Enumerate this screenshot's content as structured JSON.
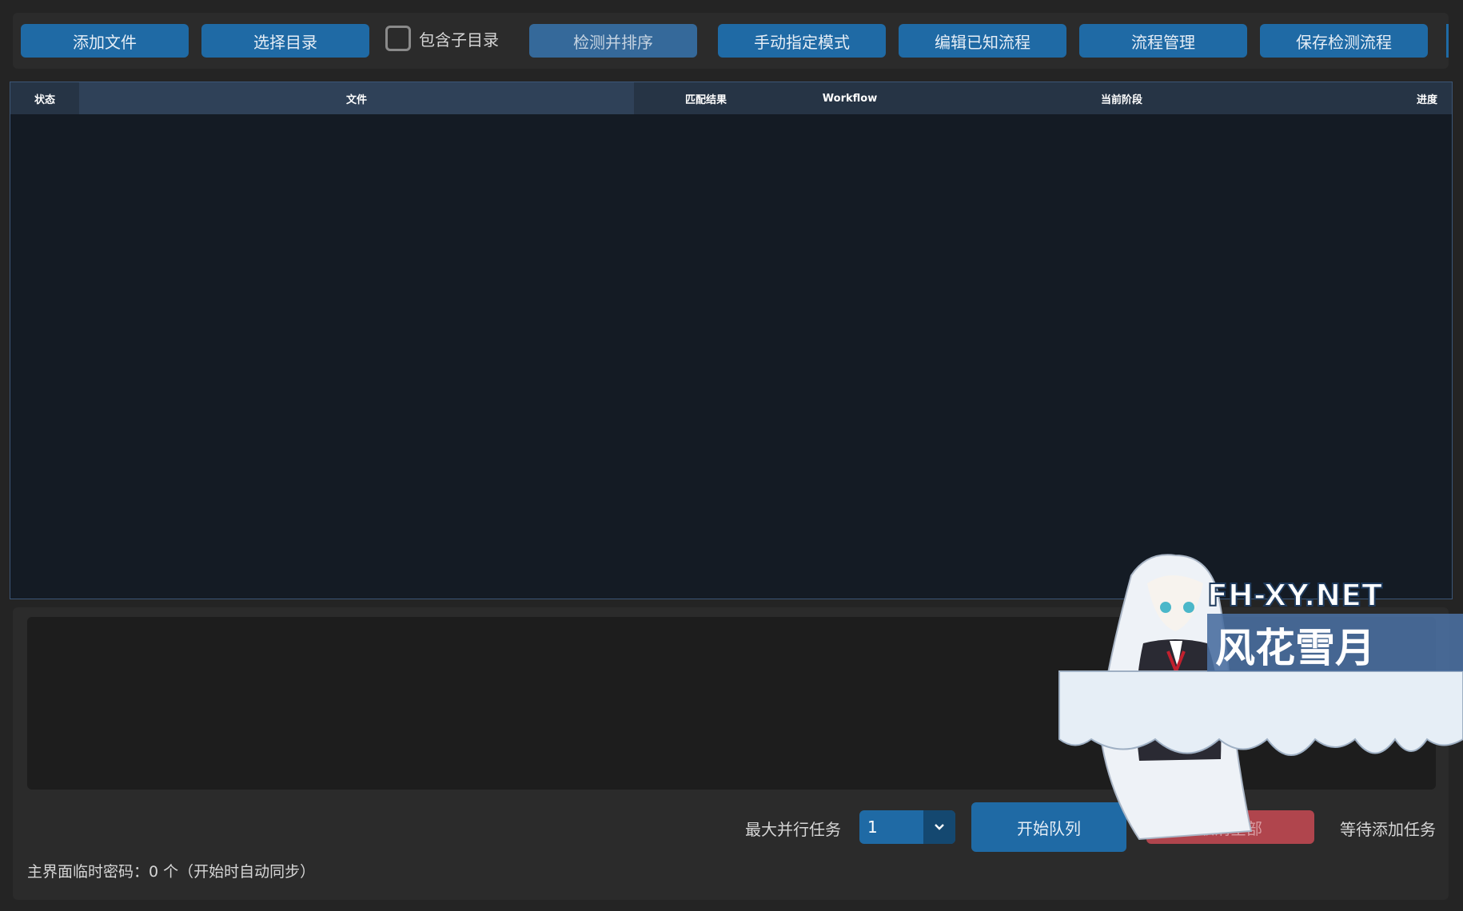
{
  "toolbar": {
    "add_file": "添加文件",
    "select_dir": "选择目录",
    "include_subdirs": "包含子目录",
    "detect_sort": "检测并排序",
    "manual_mode": "手动指定模式",
    "edit_known": "编辑已知流程",
    "manage_flow": "流程管理",
    "save_flow": "保存检测流程"
  },
  "table": {
    "columns": [
      "状态",
      "文件",
      "匹配结果",
      "Workflow",
      "当前阶段",
      "进度"
    ]
  },
  "controls": {
    "max_parallel_label": "最大并行任务",
    "max_parallel_value": "1",
    "start_queue": "开始队列",
    "cancel_all": "取消全部",
    "status": "等待添加任务"
  },
  "footer": {
    "temp_password": "主界面临时密码：0 个（开始时自动同步）"
  },
  "watermark": {
    "site": "FH-XY.NET",
    "name": "风花雪月"
  },
  "colors": {
    "accent": "#1f6aa5",
    "cancel": "#b0454d",
    "table_bg": "#141b24",
    "header_bg": "#263445"
  }
}
